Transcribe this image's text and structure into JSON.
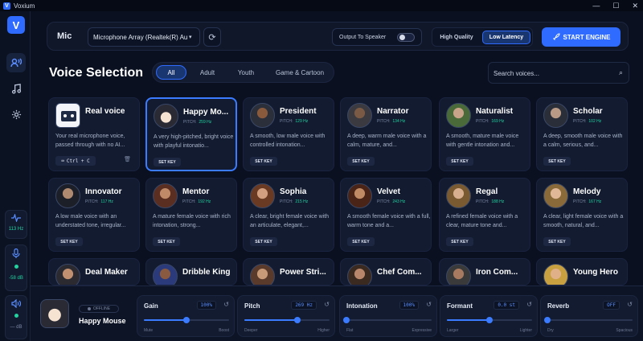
{
  "window": {
    "title": "Voxium",
    "logo_letter": "V"
  },
  "sidebar": {
    "logo_letter": "V",
    "nav": [
      {
        "icon": "voice-icon",
        "active": true
      },
      {
        "icon": "music-note-icon",
        "active": false
      },
      {
        "icon": "gear-icon",
        "active": false
      }
    ],
    "meters": {
      "pitch_value": "113 Hz",
      "mic_value": "-58 dB",
      "speaker_value": "— dB"
    }
  },
  "topbar": {
    "mic_label": "Mic",
    "mic_device": "Microphone Array (Realtek(R) Au",
    "output_label": "Output To Speaker",
    "output_enabled": false,
    "quality_high": "High Quality",
    "quality_low": "Low Latency",
    "start_label": "START ENGINE"
  },
  "main": {
    "title": "Voice Selection",
    "filters": [
      "All",
      "Adult",
      "Youth",
      "Game & Cartoon"
    ],
    "active_filter": "All",
    "search_placeholder": "Search voices..."
  },
  "voices": [
    {
      "name": "Real voice",
      "desc": "Your real microphone voice, passed through with no AI...",
      "key": "Ctrl + C",
      "real": true
    },
    {
      "name": "Happy Mo...",
      "pitch": "259 Hz",
      "desc": "A very high-pitched, bright voice with playful intonatio...",
      "selected": true
    },
    {
      "name": "President",
      "pitch": "129 Hz",
      "desc": "A smooth, low male voice with controlled intonation..."
    },
    {
      "name": "Narrator",
      "pitch": "134 Hz",
      "desc": "A deep, warm male voice with a calm, mature, and..."
    },
    {
      "name": "Naturalist",
      "pitch": "169 Hz",
      "desc": "A smooth, mature male voice with gentle intonation and..."
    },
    {
      "name": "Scholar",
      "pitch": "102 Hz",
      "desc": "A deep, smooth male voice with a calm, serious, and..."
    },
    {
      "name": "Innovator",
      "pitch": "117 Hz",
      "desc": "A low male voice with an understated tone, irregular..."
    },
    {
      "name": "Mentor",
      "pitch": "192 Hz",
      "desc": "A mature female voice with rich intonation, strong..."
    },
    {
      "name": "Sophia",
      "pitch": "215 Hz",
      "desc": "A clear, bright female voice with an articulate, elegant,..."
    },
    {
      "name": "Velvet",
      "pitch": "243 Hz",
      "desc": "A smooth female voice with a full, warm tone and a..."
    },
    {
      "name": "Regal",
      "pitch": "188 Hz",
      "desc": "A refined female voice with a clear, mature tone and..."
    },
    {
      "name": "Melody",
      "pitch": "167 Hz",
      "desc": "A clear, light female voice with a smooth, natural, and..."
    },
    {
      "name": "Deal Maker"
    },
    {
      "name": "Dribble King"
    },
    {
      "name": "Power Stri..."
    },
    {
      "name": "Chef Com..."
    },
    {
      "name": "Iron Com..."
    },
    {
      "name": "Young Hero"
    }
  ],
  "labels": {
    "pitch": "PITCH:",
    "set_key": "SET KEY"
  },
  "bottom": {
    "status": "OFFLINE",
    "voice_name": "Happy Mouse",
    "controls": [
      {
        "label": "Gain",
        "value": "100%",
        "low": "Mute",
        "high": "Boost",
        "level": 0.5
      },
      {
        "label": "Pitch",
        "value": "269 Hz",
        "low": "Deeper",
        "high": "Higher",
        "level": 0.62
      },
      {
        "label": "Intonation",
        "value": "100%",
        "low": "Flat",
        "high": "Expressive",
        "level": 0.0
      },
      {
        "label": "Formant",
        "value": "0.0 st",
        "low": "Larger",
        "high": "Lighter",
        "level": 0.5
      },
      {
        "label": "Reverb",
        "value": "OFF",
        "low": "Dry",
        "high": "Spacious",
        "level": 0.0
      }
    ]
  },
  "colors": {
    "accent": "#2f6bff",
    "pitch_green": "#22d3a0",
    "background": "#0a1020"
  }
}
